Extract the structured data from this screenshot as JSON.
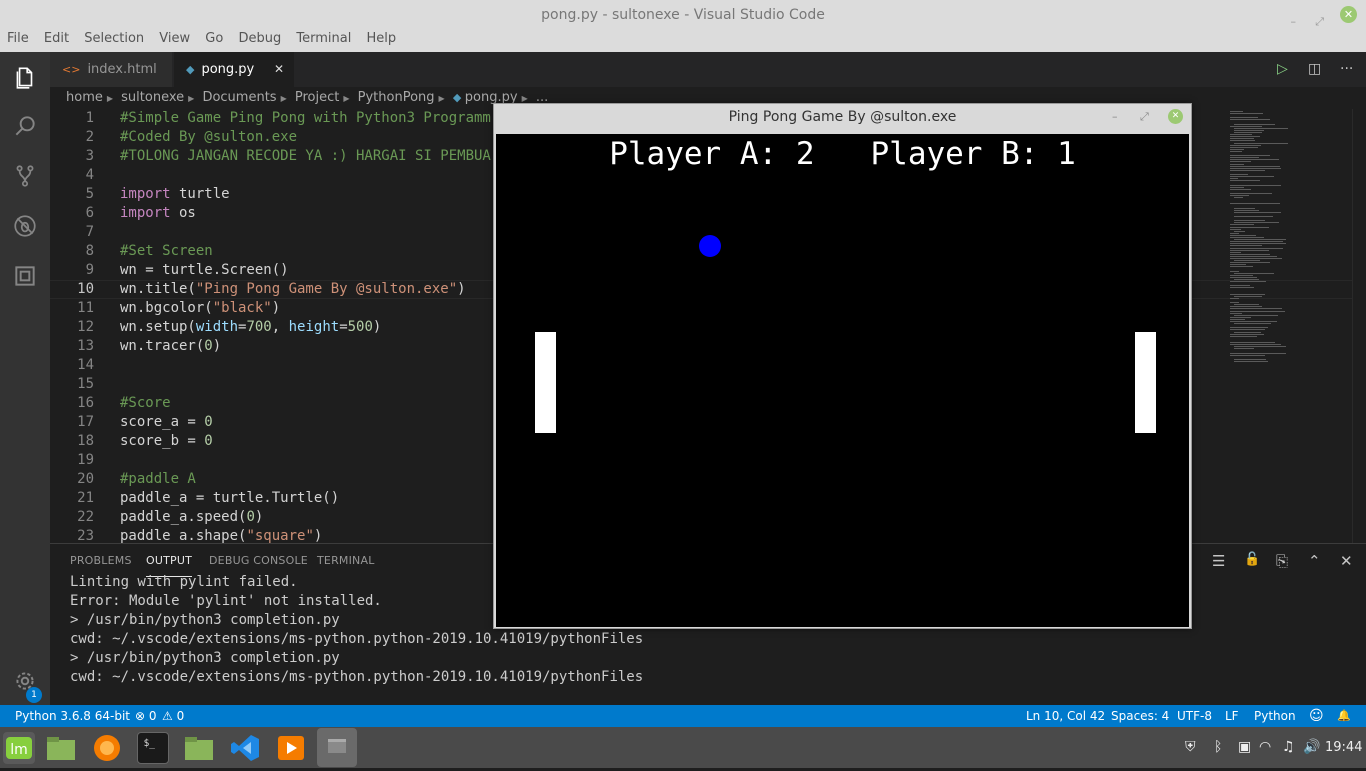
{
  "window": {
    "title": "pong.py - sultonexe - Visual Studio Code",
    "controls": {
      "minimize": "–",
      "maximize": "⤢",
      "close": "✕"
    }
  },
  "menu": [
    "File",
    "Edit",
    "Selection",
    "View",
    "Go",
    "Debug",
    "Terminal",
    "Help"
  ],
  "activity_bar": [
    "files-icon",
    "search-icon",
    "source-control-icon",
    "debug-icon",
    "extensions-icon",
    "gear-icon"
  ],
  "settings_badge": "1",
  "tabs": [
    {
      "label": "index.html",
      "icon": "html-icon",
      "active": false
    },
    {
      "label": "pong.py",
      "icon": "python-icon",
      "active": true,
      "close": "✕"
    }
  ],
  "breadcrumb": [
    "home",
    "sultonexe",
    "Documents",
    "Project",
    "PythonPong",
    "pong.py",
    "..."
  ],
  "editor": {
    "line_numbers": [
      "1",
      "2",
      "3",
      "4",
      "5",
      "6",
      "7",
      "8",
      "9",
      "10",
      "11",
      "12",
      "13",
      "14",
      "15",
      "16",
      "17",
      "18",
      "19",
      "20",
      "21",
      "22",
      "23"
    ],
    "current_line": "10",
    "lines": {
      "l1": "#Simple Game Ping Pong with Python3 Programm",
      "l2": "#Coded By @sulton.exe",
      "l3": "#TOLONG JANGAN RECODE YA :) HARGAI SI PEMBUA",
      "l5_kw": "import",
      "l5_rest": " turtle",
      "l6_kw": "import",
      "l6_rest": " os",
      "l8": "#Set Screen",
      "l9": "wn = turtle.Screen()",
      "l10_a": "wn.title(",
      "l10_s": "\"Ping Pong Game By @sulton.exe\"",
      "l10_b": ")",
      "l11_a": "wn.bgcolor(",
      "l11_s": "\"black\"",
      "l11_b": ")",
      "l12_a": "wn.setup(",
      "l12_p1": "width",
      "l12_eq1": "=",
      "l12_n1": "700",
      "l12_c": ", ",
      "l12_p2": "height",
      "l12_eq2": "=",
      "l12_n2": "500",
      "l12_b": ")",
      "l13_a": "wn.tracer(",
      "l13_n": "0",
      "l13_b": ")",
      "l16": "#Score",
      "l17_a": "score_a = ",
      "l17_n": "0",
      "l18_a": "score_b = ",
      "l18_n": "0",
      "l20": "#paddle A",
      "l21": "paddle_a = turtle.Turtle()",
      "l22_a": "paddle_a.speed(",
      "l22_n": "0",
      "l22_b": ")",
      "l23_a": "paddle_a.shape(",
      "l23_s": "\"square\"",
      "l23_b": ")"
    }
  },
  "editor_actions": {
    "run": "▷",
    "split": "◫",
    "more": "···"
  },
  "panel": {
    "tabs": [
      "PROBLEMS",
      "OUTPUT",
      "DEBUG CONSOLE",
      "TERMINAL"
    ],
    "active_tab": "OUTPUT",
    "output": [
      "Linting with pylint failed.",
      "Error: Module 'pylint' not installed.",
      "> /usr/bin/python3 completion.py",
      "cwd: ~/.vscode/extensions/ms-python.python-2019.10.41019/pythonFiles",
      "> /usr/bin/python3 completion.py",
      "cwd: ~/.vscode/extensions/ms-python.python-2019.10.41019/pythonFiles"
    ],
    "actions": {
      "clear": "☰",
      "lock": "🔓",
      "open": "⎘",
      "maximize": "⌃",
      "close": "✕"
    }
  },
  "statusbar": {
    "python": "Python 3.6.8 64-bit",
    "errors": "⊗ 0",
    "warnings": "⚠ 0",
    "position": "Ln 10, Col 42",
    "spaces": "Spaces: 4",
    "encoding": "UTF-8",
    "eol": "LF",
    "language": "Python",
    "feedback": "☺",
    "bell": "🔔"
  },
  "pong_window": {
    "title": "Ping Pong Game By @sulton.exe",
    "controls": {
      "minimize": "–",
      "maximize": "⤢",
      "close": "✕"
    },
    "score_text": "Player A: 2   Player B: 1",
    "score_a": 2,
    "score_b": 1,
    "background": "#000000",
    "ball_color": "#0000ff",
    "paddle_color": "#ffffff"
  },
  "taskbar": {
    "apps": [
      "mint-menu-icon",
      "files-icon",
      "firefox-icon",
      "terminal-icon",
      "folder-icon",
      "vscode-icon",
      "media-player-icon",
      "window-icon"
    ],
    "tray": [
      "shield-icon",
      "bluetooth-icon",
      "network-manager-icon",
      "wifi-icon",
      "music-icon",
      "volume-icon"
    ],
    "clock": "19:44"
  },
  "colors": {
    "accent": "#007acc",
    "editor_bg": "#1e1e1e",
    "comment": "#6a9955",
    "string": "#ce9178",
    "number": "#b5cea8",
    "keyword": "#c586c0"
  }
}
